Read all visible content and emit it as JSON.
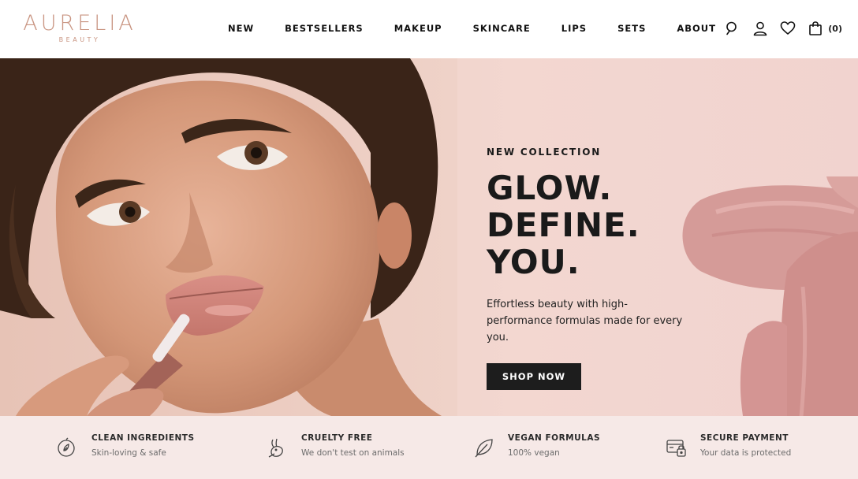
{
  "brand": {
    "name": "AURELIA",
    "tagline": "BEAUTY",
    "color": "#c99582"
  },
  "nav": {
    "items": [
      {
        "label": "NEW"
      },
      {
        "label": "BESTSELLERS"
      },
      {
        "label": "MAKEUP"
      },
      {
        "label": "SKINCARE"
      },
      {
        "label": "LIPS"
      },
      {
        "label": "SETS"
      },
      {
        "label": "ABOUT"
      }
    ]
  },
  "header_icons": {
    "search": "search-icon",
    "account": "user-icon",
    "wishlist": "heart-icon",
    "cart": "bag-icon",
    "cart_count": "(0)"
  },
  "hero": {
    "eyebrow": "NEW COLLECTION",
    "headline": [
      "GLOW.",
      "DEFINE.",
      "YOU."
    ],
    "subcopy": "Effortless beauty with high-performance formulas made for every you.",
    "cta": "SHOP NOW",
    "background": "#f1d3cf",
    "cta_color": "#1d1d1d"
  },
  "features": [
    {
      "icon": "drop-leaf-icon",
      "title": "CLEAN INGREDIENTS",
      "subtitle": "Skin-loving & safe"
    },
    {
      "icon": "bunny-icon",
      "title": "CRUELTY FREE",
      "subtitle": "We don't test on animals"
    },
    {
      "icon": "leaf-icon",
      "title": "VEGAN FORMULAS",
      "subtitle": "100% vegan"
    },
    {
      "icon": "secure-card-icon",
      "title": "SECURE PAYMENT",
      "subtitle": "Your data is protected"
    }
  ]
}
